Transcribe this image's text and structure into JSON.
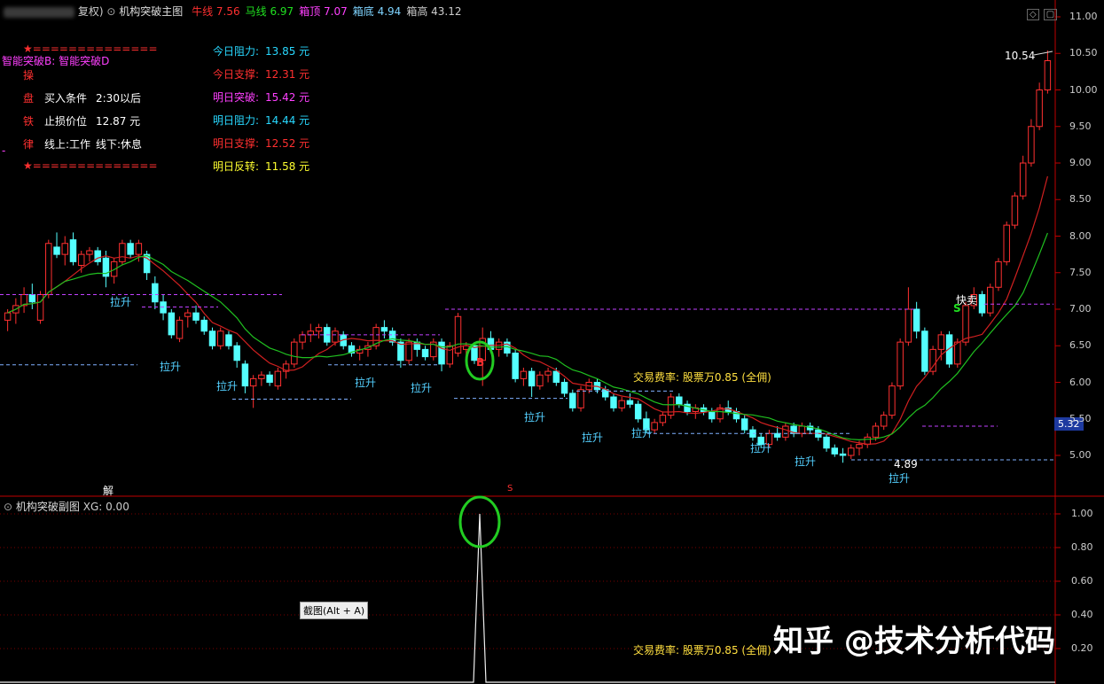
{
  "header": {
    "prefix": "复权)",
    "indicator_name": "机构突破主图",
    "items": [
      {
        "label": "牛线",
        "value": "7.56",
        "color": "#ff3030"
      },
      {
        "label": "马线",
        "value": "6.97",
        "color": "#20e020"
      },
      {
        "label": "箱顶",
        "value": "7.07",
        "color": "#ff40ff"
      },
      {
        "label": "箱底",
        "value": "4.94",
        "color": "#7fd4ff"
      },
      {
        "label": "箱高",
        "value": "43.12",
        "color": "#cccccc"
      }
    ]
  },
  "panel_left": {
    "top_line": "★==============",
    "subtitle": "智能突破B: 智能突破D",
    "rows": [
      {
        "icon": "操",
        "label": "",
        "value": ""
      },
      {
        "icon": "盘",
        "label": "买入条件",
        "value": "2:30以后"
      },
      {
        "icon": "铁",
        "label": "止损价位",
        "value": "12.87 元"
      },
      {
        "icon": "律",
        "label": "线上:工作",
        "value": "线下:休息"
      }
    ],
    "bottom_line": "★==============",
    "dash": "-"
  },
  "panel_right": [
    {
      "label": "今日阻力:",
      "value": "13.85 元",
      "color": "#28d8ff"
    },
    {
      "label": "今日支撑:",
      "value": "12.31 元",
      "color": "#ff3030"
    },
    {
      "label": "明日突破:",
      "value": "15.42 元",
      "color": "#ff40ff"
    },
    {
      "label": "明日阻力:",
      "value": "14.44 元",
      "color": "#28d8ff"
    },
    {
      "label": "明日支撑:",
      "value": "12.52 元",
      "color": "#ff3030"
    },
    {
      "label": "明日反转:",
      "value": "11.58 元",
      "color": "#ffff30"
    }
  ],
  "annotations": {
    "lashing": "拉升",
    "fast_sell": "快卖",
    "fee_text": "交易费率: 股票万0.85 (全佣)",
    "high_label": "10.54",
    "low_label": "4.89",
    "buy_mark": "B",
    "sell_mark": "S",
    "jie_mark": "解",
    "s_marker": "S",
    "current_price": "5.32"
  },
  "main_axis_ticks": [
    "11.00",
    "10.50",
    "10.00",
    "9.50",
    "9.00",
    "8.50",
    "8.00",
    "7.50",
    "7.00",
    "6.50",
    "6.00",
    "5.50",
    "5.00"
  ],
  "sub_panel": {
    "title": "机构突破副图",
    "xg_label": "XG: 0.00",
    "axis_ticks": [
      "1.00",
      "0.80",
      "0.60",
      "0.40",
      "0.20"
    ],
    "fee_text": "交易费率: 股票万0.85 (全佣)",
    "tooltip": "截图(Alt + A)"
  },
  "watermark": "知乎 @技术分析代码",
  "colors": {
    "up": "#ff3030",
    "down": "#54ffff",
    "ma_red": "#d02020",
    "ma_green": "#20c020",
    "grid": "#7a0000"
  },
  "lashing_count": 12,
  "chart_data": {
    "type": "candlestick",
    "price_range": [
      4.6,
      11.15
    ],
    "series": [
      {
        "name": "牛线",
        "last": 7.56
      },
      {
        "name": "马线",
        "last": 6.97
      }
    ],
    "box_top": 7.07,
    "box_bottom": 4.94,
    "high": 10.54,
    "low": 4.89,
    "current": 5.32,
    "ohlc": [
      [
        6.85,
        7.0,
        6.7,
        6.95
      ],
      [
        6.95,
        7.15,
        6.8,
        7.05
      ],
      [
        7.05,
        7.3,
        6.95,
        7.2
      ],
      [
        7.2,
        7.35,
        7.0,
        7.1
      ],
      [
        6.85,
        7.25,
        6.8,
        7.2
      ],
      [
        7.2,
        7.95,
        7.15,
        7.9
      ],
      [
        7.85,
        8.05,
        7.7,
        7.75
      ],
      [
        7.75,
        8.0,
        7.6,
        7.9
      ],
      [
        7.95,
        8.05,
        7.6,
        7.65
      ],
      [
        7.6,
        7.8,
        7.5,
        7.75
      ],
      [
        7.75,
        7.85,
        7.65,
        7.8
      ],
      [
        7.8,
        7.85,
        7.6,
        7.65
      ],
      [
        7.7,
        7.8,
        7.3,
        7.45
      ],
      [
        7.45,
        7.7,
        7.35,
        7.65
      ],
      [
        7.65,
        7.95,
        7.6,
        7.9
      ],
      [
        7.9,
        7.95,
        7.7,
        7.75
      ],
      [
        7.75,
        7.95,
        7.65,
        7.9
      ],
      [
        7.75,
        7.8,
        7.4,
        7.5
      ],
      [
        7.35,
        7.45,
        7.0,
        7.1
      ],
      [
        7.1,
        7.2,
        6.85,
        6.95
      ],
      [
        6.95,
        7.0,
        6.6,
        6.65
      ],
      [
        6.6,
        6.9,
        6.55,
        6.85
      ],
      [
        6.9,
        7.0,
        6.75,
        6.95
      ],
      [
        6.95,
        7.05,
        6.8,
        6.85
      ],
      [
        6.85,
        6.9,
        6.65,
        6.7
      ],
      [
        6.7,
        6.75,
        6.45,
        6.5
      ],
      [
        6.5,
        6.75,
        6.45,
        6.7
      ],
      [
        6.65,
        6.7,
        6.45,
        6.5
      ],
      [
        6.5,
        6.55,
        6.2,
        6.3
      ],
      [
        6.25,
        6.3,
        5.85,
        5.95
      ],
      [
        5.95,
        6.1,
        5.65,
        6.05
      ],
      [
        6.05,
        6.15,
        5.95,
        6.1
      ],
      [
        6.1,
        6.15,
        5.95,
        6.0
      ],
      [
        5.95,
        6.2,
        5.9,
        6.15
      ],
      [
        6.15,
        6.3,
        6.05,
        6.25
      ],
      [
        6.25,
        6.6,
        6.2,
        6.55
      ],
      [
        6.55,
        6.7,
        6.45,
        6.65
      ],
      [
        6.65,
        6.8,
        6.55,
        6.7
      ],
      [
        6.7,
        6.8,
        6.6,
        6.75
      ],
      [
        6.75,
        6.8,
        6.5,
        6.55
      ],
      [
        6.55,
        6.75,
        6.5,
        6.7
      ],
      [
        6.65,
        6.7,
        6.45,
        6.5
      ],
      [
        6.5,
        6.55,
        6.35,
        6.4
      ],
      [
        6.4,
        6.5,
        6.3,
        6.45
      ],
      [
        6.45,
        6.55,
        6.35,
        6.5
      ],
      [
        6.5,
        6.8,
        6.45,
        6.75
      ],
      [
        6.75,
        6.85,
        6.6,
        6.7
      ],
      [
        6.7,
        6.75,
        6.5,
        6.55
      ],
      [
        6.55,
        6.6,
        6.2,
        6.3
      ],
      [
        6.3,
        6.6,
        6.25,
        6.55
      ],
      [
        6.55,
        6.6,
        6.35,
        6.45
      ],
      [
        6.45,
        6.5,
        6.3,
        6.35
      ],
      [
        6.35,
        6.6,
        6.3,
        6.55
      ],
      [
        6.55,
        6.6,
        6.15,
        6.25
      ],
      [
        6.25,
        6.55,
        6.2,
        6.5
      ],
      [
        6.4,
        6.95,
        6.35,
        6.9
      ],
      [
        6.45,
        6.55,
        6.35,
        6.5
      ],
      [
        6.5,
        6.55,
        6.25,
        6.3
      ],
      [
        6.3,
        6.75,
        5.95,
        6.6
      ],
      [
        6.6,
        6.7,
        6.4,
        6.45
      ],
      [
        6.45,
        6.6,
        6.35,
        6.55
      ],
      [
        6.55,
        6.6,
        6.35,
        6.4
      ],
      [
        6.4,
        6.45,
        6.0,
        6.05
      ],
      [
        6.05,
        6.2,
        5.95,
        6.15
      ],
      [
        6.15,
        6.2,
        5.8,
        5.95
      ],
      [
        5.95,
        6.15,
        5.9,
        6.1
      ],
      [
        6.1,
        6.2,
        6.0,
        6.15
      ],
      [
        6.15,
        6.2,
        5.95,
        6.0
      ],
      [
        6.0,
        6.05,
        5.8,
        5.85
      ],
      [
        5.85,
        5.9,
        5.6,
        5.65
      ],
      [
        5.65,
        5.95,
        5.6,
        5.9
      ],
      [
        5.9,
        6.05,
        5.85,
        6.0
      ],
      [
        6.0,
        6.05,
        5.85,
        5.9
      ],
      [
        5.9,
        5.95,
        5.75,
        5.8
      ],
      [
        5.8,
        5.85,
        5.6,
        5.65
      ],
      [
        5.65,
        5.8,
        5.6,
        5.75
      ],
      [
        5.75,
        5.85,
        5.65,
        5.7
      ],
      [
        5.7,
        5.75,
        5.45,
        5.5
      ],
      [
        5.5,
        5.6,
        5.3,
        5.35
      ],
      [
        5.35,
        5.5,
        5.3,
        5.45
      ],
      [
        5.45,
        5.6,
        5.4,
        5.55
      ],
      [
        5.55,
        5.85,
        5.5,
        5.8
      ],
      [
        5.8,
        5.85,
        5.65,
        5.7
      ],
      [
        5.7,
        5.75,
        5.55,
        5.6
      ],
      [
        5.6,
        5.7,
        5.5,
        5.65
      ],
      [
        5.65,
        5.7,
        5.55,
        5.6
      ],
      [
        5.6,
        5.65,
        5.45,
        5.5
      ],
      [
        5.5,
        5.7,
        5.45,
        5.65
      ],
      [
        5.65,
        5.75,
        5.55,
        5.6
      ],
      [
        5.6,
        5.65,
        5.45,
        5.5
      ],
      [
        5.5,
        5.55,
        5.3,
        5.35
      ],
      [
        5.35,
        5.4,
        5.2,
        5.25
      ],
      [
        5.25,
        5.3,
        5.1,
        5.15
      ],
      [
        5.15,
        5.35,
        5.1,
        5.3
      ],
      [
        5.3,
        5.4,
        5.2,
        5.25
      ],
      [
        5.25,
        5.45,
        5.2,
        5.4
      ],
      [
        5.4,
        5.45,
        5.25,
        5.3
      ],
      [
        5.3,
        5.45,
        5.25,
        5.4
      ],
      [
        5.4,
        5.45,
        5.3,
        5.35
      ],
      [
        5.35,
        5.4,
        5.2,
        5.25
      ],
      [
        5.25,
        5.3,
        5.05,
        5.1
      ],
      [
        5.1,
        5.15,
        4.98,
        5.02
      ],
      [
        5.02,
        5.1,
        4.9,
        5.0
      ],
      [
        5.0,
        5.15,
        4.95,
        5.1
      ],
      [
        5.1,
        5.2,
        5.0,
        5.15
      ],
      [
        5.15,
        5.3,
        5.1,
        5.25
      ],
      [
        5.25,
        5.45,
        5.2,
        5.4
      ],
      [
        5.4,
        5.6,
        5.35,
        5.55
      ],
      [
        5.55,
        6.0,
        5.5,
        5.95
      ],
      [
        5.95,
        6.6,
        5.9,
        6.55
      ],
      [
        6.55,
        7.3,
        6.5,
        7.0
      ],
      [
        7.0,
        7.1,
        6.6,
        6.7
      ],
      [
        6.7,
        6.75,
        6.1,
        6.15
      ],
      [
        6.15,
        6.5,
        6.1,
        6.45
      ],
      [
        6.45,
        6.7,
        6.3,
        6.65
      ],
      [
        6.65,
        6.7,
        6.2,
        6.25
      ],
      [
        6.25,
        6.6,
        6.2,
        6.55
      ],
      [
        6.55,
        7.1,
        6.5,
        7.05
      ],
      [
        7.05,
        7.3,
        7.0,
        7.2
      ],
      [
        7.2,
        7.25,
        6.9,
        6.95
      ],
      [
        6.95,
        7.35,
        6.9,
        7.3
      ],
      [
        7.3,
        7.7,
        7.25,
        7.65
      ],
      [
        7.65,
        8.2,
        7.6,
        8.15
      ],
      [
        8.15,
        8.6,
        8.1,
        8.55
      ],
      [
        8.55,
        9.1,
        8.5,
        9.0
      ],
      [
        9.0,
        9.6,
        8.95,
        9.5
      ],
      [
        9.5,
        10.1,
        9.45,
        10.0
      ],
      [
        10.0,
        10.54,
        9.95,
        10.4
      ]
    ]
  }
}
